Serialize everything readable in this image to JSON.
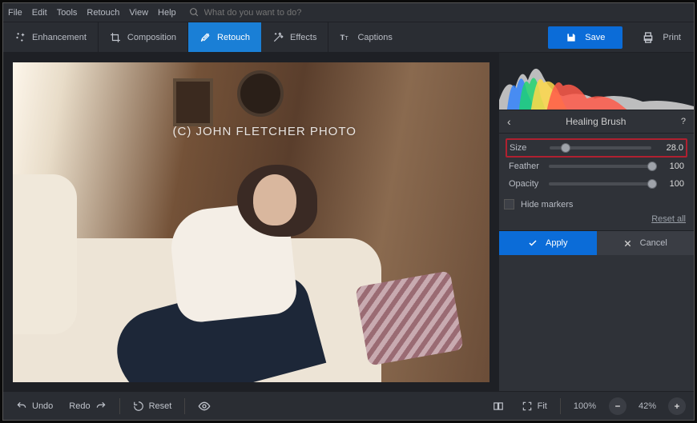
{
  "menu": {
    "items": [
      "File",
      "Edit",
      "Tools",
      "Retouch",
      "View",
      "Help"
    ],
    "search_placeholder": "What do you want to do?"
  },
  "toolbar": {
    "tabs": [
      {
        "label": "Enhancement"
      },
      {
        "label": "Composition"
      },
      {
        "label": "Retouch"
      },
      {
        "label": "Effects"
      },
      {
        "label": "Captions"
      }
    ],
    "active_tab": 2,
    "save_label": "Save",
    "print_label": "Print"
  },
  "canvas": {
    "watermark": "(C) JOHN FLETCHER PHOTO"
  },
  "panel": {
    "title": "Healing Brush",
    "sliders": [
      {
        "id": "size",
        "label": "Size",
        "value_text": "28.0",
        "pct": 16,
        "highlight": true
      },
      {
        "id": "feather",
        "label": "Feather",
        "value_text": "100",
        "pct": 100,
        "highlight": false
      },
      {
        "id": "opacity",
        "label": "Opacity",
        "value_text": "100",
        "pct": 100,
        "highlight": false
      }
    ],
    "hide_markers_label": "Hide markers",
    "reset_label": "Reset all",
    "apply_label": "Apply",
    "cancel_label": "Cancel"
  },
  "bottombar": {
    "undo_label": "Undo",
    "redo_label": "Redo",
    "reset_label": "Reset",
    "fit_label": "Fit",
    "zoom1": "100%",
    "zoom2": "42%"
  }
}
